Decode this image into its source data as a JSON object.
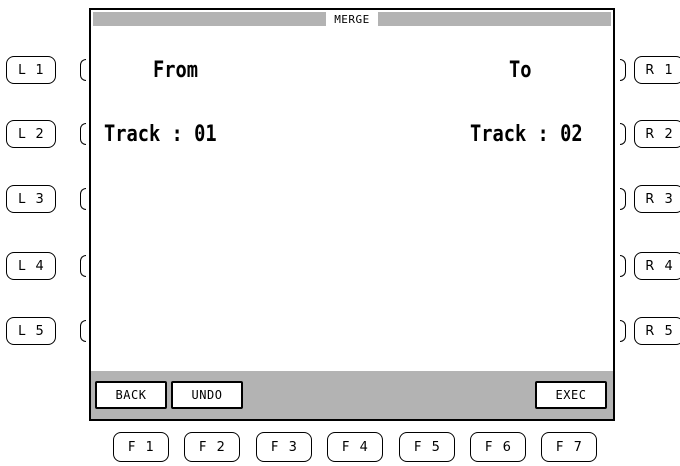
{
  "screen": {
    "title": "MERGE",
    "from_label": "From",
    "to_label": "To",
    "from_value": "Track : 01",
    "to_value": "Track : 02"
  },
  "softkeys": {
    "back": "BACK",
    "undo": "UNDO",
    "exec": "EXEC"
  },
  "left_keys": [
    "L 1",
    "L 2",
    "L 3",
    "L 4",
    "L 5"
  ],
  "right_keys": [
    "R 1",
    "R 2",
    "R 3",
    "R 4",
    "R 5"
  ],
  "function_keys": [
    "F 1",
    "F 2",
    "F 3",
    "F 4",
    "F 5",
    "F 6",
    "F 7"
  ],
  "colors": {
    "bar_gray": "#b3b3b3"
  }
}
